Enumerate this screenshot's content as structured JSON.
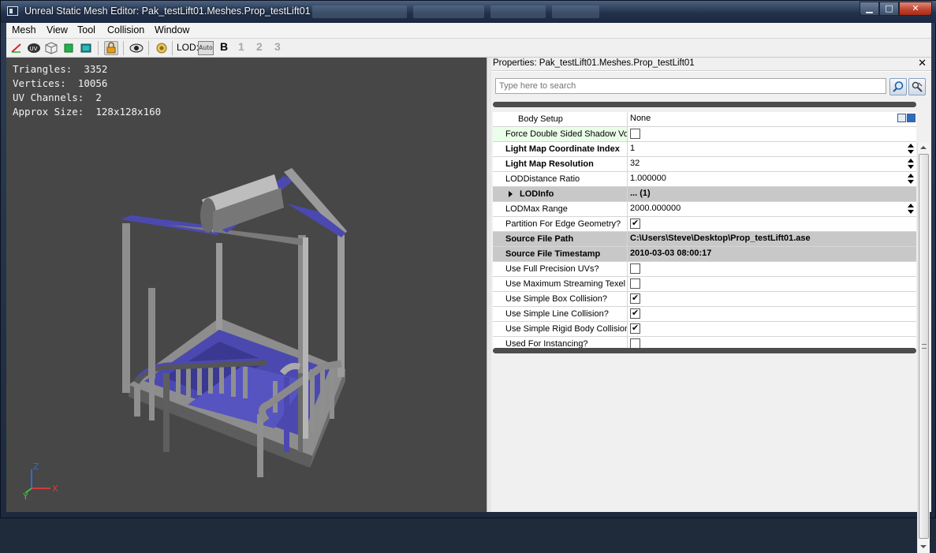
{
  "window": {
    "title": "Unreal Static Mesh Editor: Pak_testLift01.Meshes.Prop_testLift01",
    "minimize_glyph": "▁",
    "maximize_glyph": "□",
    "close_glyph": "✕"
  },
  "menu": [
    "Mesh",
    "View",
    "Tool",
    "Collision",
    "Window"
  ],
  "toolbar": {
    "icons": [
      "draw-edges-icon",
      "uv-icon",
      "wireframe-cube-icon",
      "green-box-icon",
      "teal-box-icon",
      "lock-icon",
      "eye-icon",
      "socket-icon"
    ],
    "lod_label": "LOD:",
    "auto_label": "Auto",
    "base_label": "B",
    "lod_levels": [
      "1",
      "2",
      "3"
    ]
  },
  "viewport": {
    "stats": [
      {
        "label": "Triangles:",
        "value": "3352"
      },
      {
        "label": "Vertices:",
        "value": "10056"
      },
      {
        "label": "UV Channels:",
        "value": "2"
      },
      {
        "label": "Approx Size:",
        "value": "128x128x160"
      }
    ],
    "axes": {
      "x": "X",
      "y": "Y",
      "z": "Z"
    }
  },
  "properties": {
    "title": "Properties: Pak_testLift01.Meshes.Prop_testLift01",
    "close_glyph": "✕",
    "search_placeholder": "Type here to search",
    "rows": [
      {
        "name": "Body Setup",
        "value": "None",
        "kind": "object"
      },
      {
        "name": "Force Double Sided Shadow Volu",
        "kind": "check",
        "checked": false
      },
      {
        "name": "Light Map Coordinate Index",
        "value": "1",
        "kind": "spin"
      },
      {
        "name": "Light Map Resolution",
        "value": "32",
        "kind": "spin"
      },
      {
        "name": "LODDistance Ratio",
        "value": "1.000000",
        "kind": "spin"
      },
      {
        "name": "LODInfo",
        "value": "... (1)",
        "kind": "expand"
      },
      {
        "name": "LODMax Range",
        "value": "2000.000000",
        "kind": "spin"
      },
      {
        "name": "Partition For Edge Geometry?",
        "kind": "check",
        "checked": true
      },
      {
        "name": "Source File Path",
        "value": "C:\\Users\\Steve\\Desktop\\Prop_testLift01.ase",
        "kind": "readonly"
      },
      {
        "name": "Source File Timestamp",
        "value": "2010-03-03 08:00:17",
        "kind": "readonly"
      },
      {
        "name": "Use Full Precision UVs?",
        "kind": "check",
        "checked": false
      },
      {
        "name": "Use Maximum Streaming Texel R",
        "kind": "check",
        "checked": false
      },
      {
        "name": "Use Simple Box Collision?",
        "kind": "check",
        "checked": true
      },
      {
        "name": "Use Simple Line Collision?",
        "kind": "check",
        "checked": true
      },
      {
        "name": "Use Simple Rigid Body Collision?",
        "kind": "check",
        "checked": true
      },
      {
        "name": "Used For Instancing?",
        "kind": "check",
        "checked": false
      }
    ]
  },
  "colors": {
    "viewport_bg": "#474747",
    "mesh_blue": "#4b49b0",
    "mesh_gray": "#9a9a9a",
    "selected_row": "#c8c8c8",
    "highlight_row": "#eaffea"
  }
}
